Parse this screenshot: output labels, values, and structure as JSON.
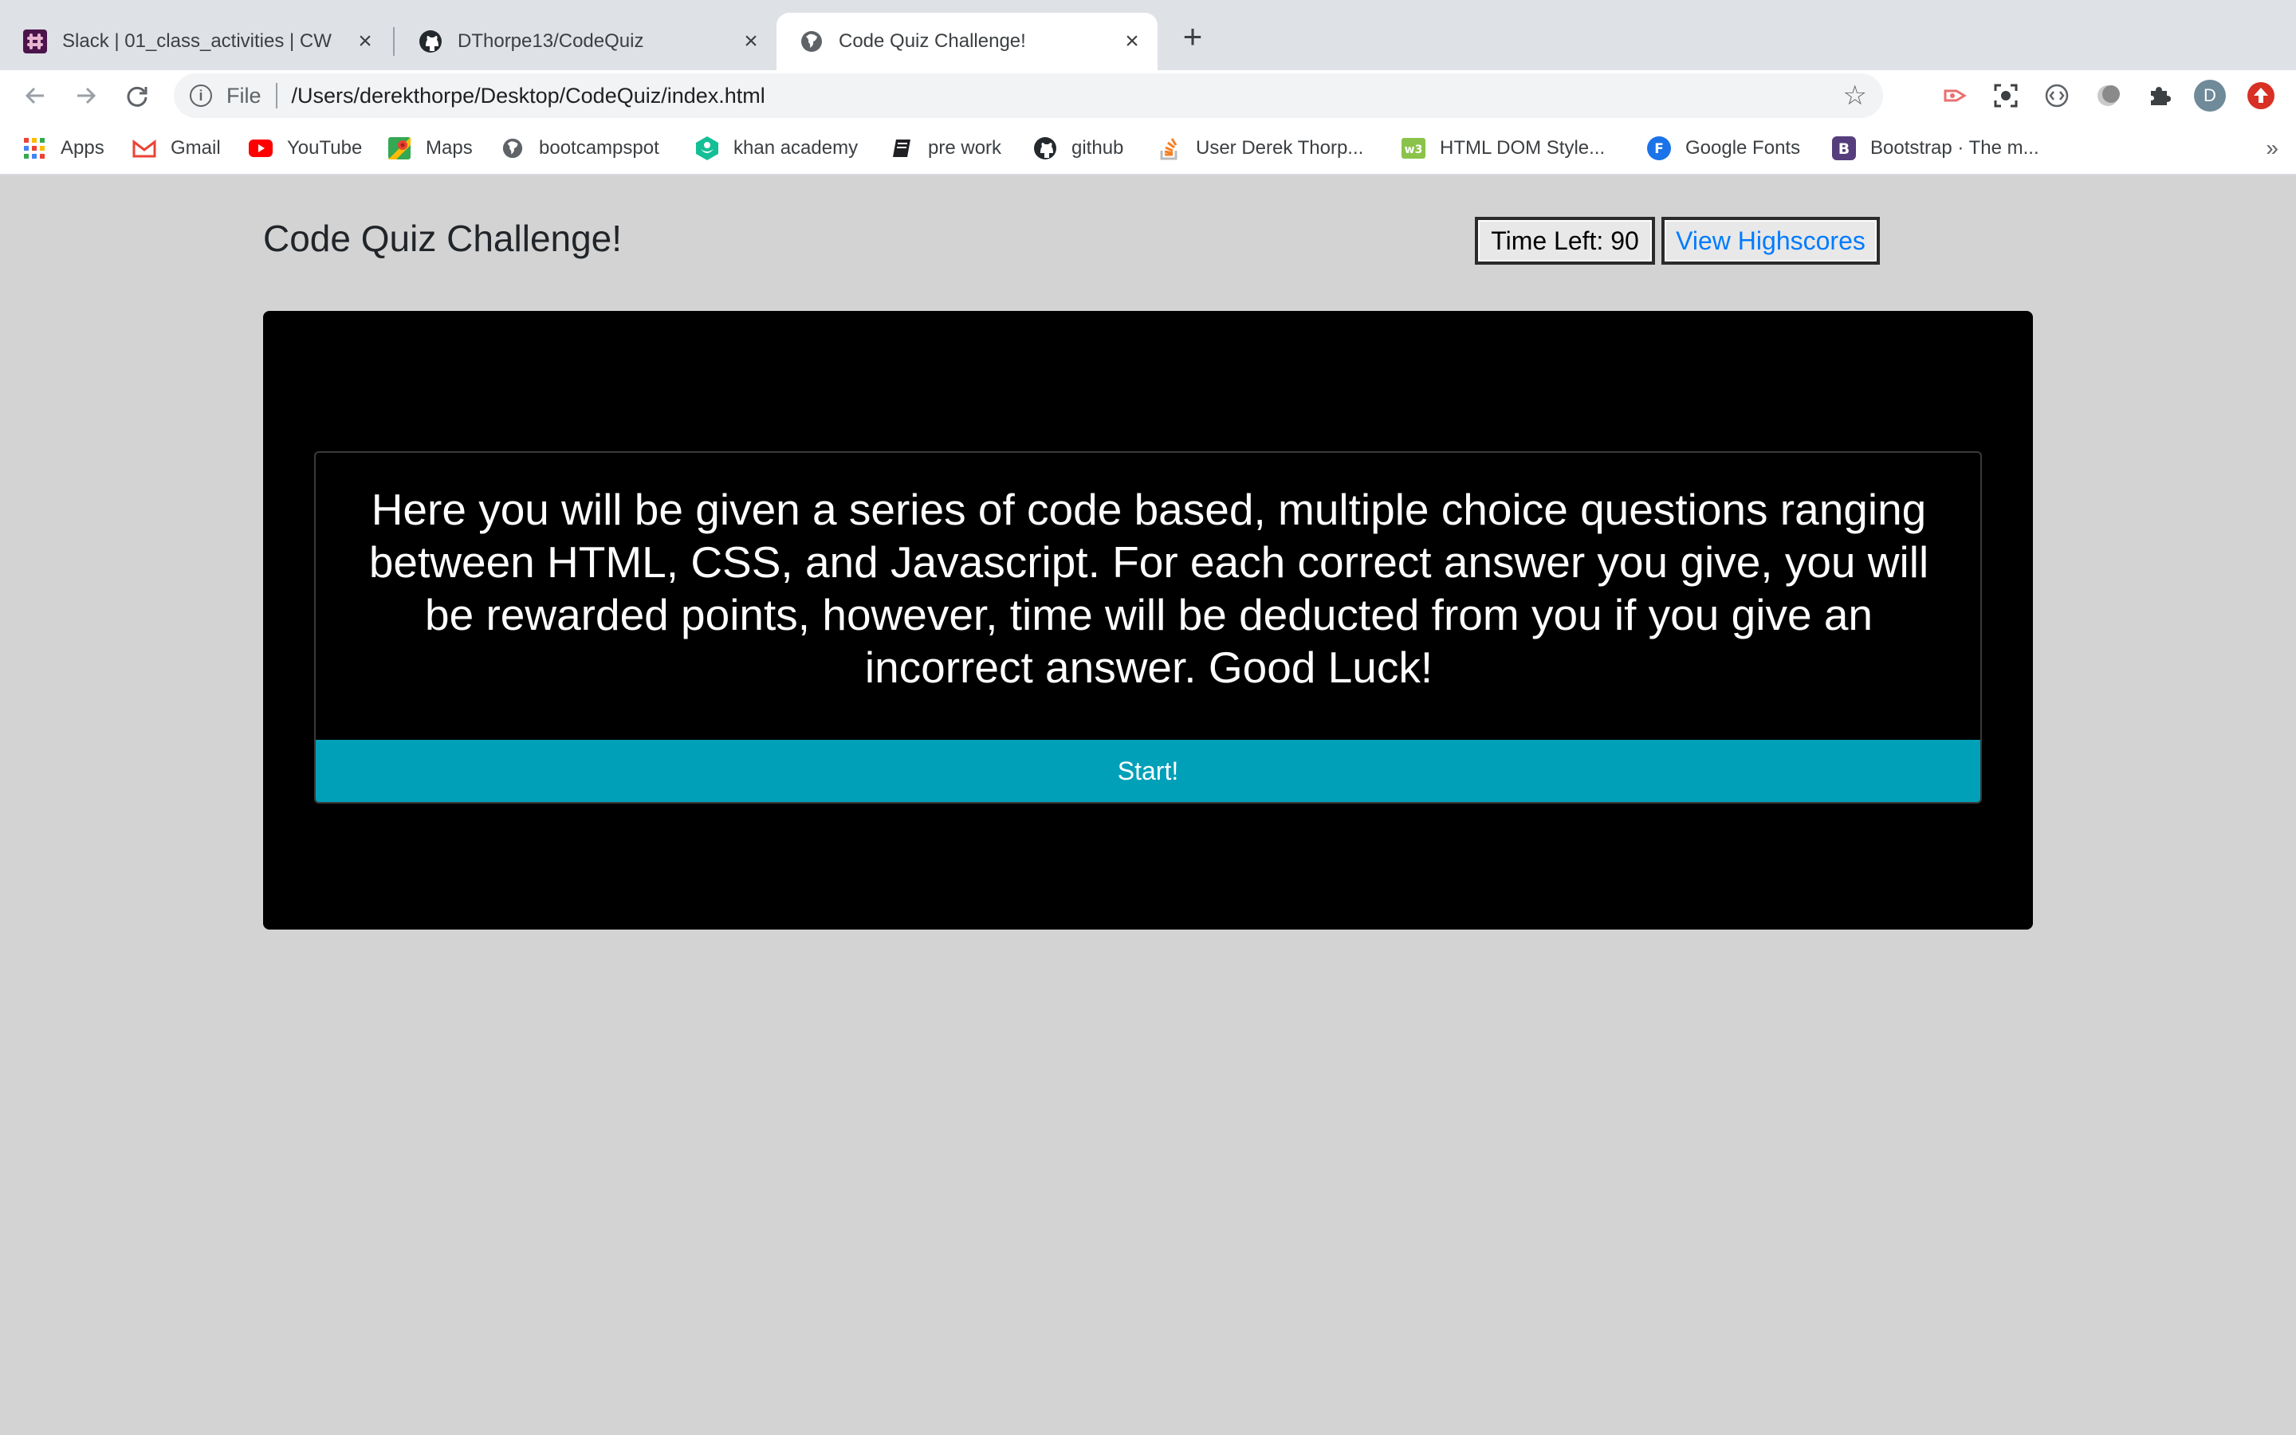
{
  "browser": {
    "tabs": [
      {
        "title": "Slack | 01_class_activities | CW",
        "icon": "slack-icon",
        "active": false
      },
      {
        "title": "DThorpe13/CodeQuiz",
        "icon": "github-icon",
        "active": false
      },
      {
        "title": "Code Quiz Challenge!",
        "icon": "globe-icon",
        "active": true
      }
    ],
    "address": {
      "scheme_label": "File",
      "url": "/Users/derekthorpe/Desktop/CodeQuiz/index.html"
    },
    "profile_initial": "D",
    "bookmarks": [
      {
        "label": "Apps",
        "icon": "apps-grid-icon"
      },
      {
        "label": "Gmail",
        "icon": "gmail-icon"
      },
      {
        "label": "YouTube",
        "icon": "youtube-icon"
      },
      {
        "label": "Maps",
        "icon": "maps-icon"
      },
      {
        "label": "bootcampspot",
        "icon": "globe-icon"
      },
      {
        "label": "khan academy",
        "icon": "khan-academy-icon"
      },
      {
        "label": "pre work",
        "icon": "book-icon"
      },
      {
        "label": "github",
        "icon": "github-icon"
      },
      {
        "label": "User Derek Thorp...",
        "icon": "stackoverflow-icon"
      },
      {
        "label": "HTML DOM Style...",
        "icon": "w3schools-icon"
      },
      {
        "label": "Google Fonts",
        "icon": "google-fonts-icon"
      },
      {
        "label": "Bootstrap · The m...",
        "icon": "bootstrap-icon"
      }
    ],
    "overflow_label": "»"
  },
  "page": {
    "title": "Code Quiz Challenge!",
    "timer_label": "Time Left: 90",
    "highscores_label": "View Highscores",
    "intro_text": "Here you will be given a series of code based, multiple choice questions ranging between HTML, CSS, and Javascript. For each correct answer you give, you will be rewarded points, however, time will be deducted from you if you give an incorrect answer. Good Luck!",
    "start_label": "Start!"
  },
  "colors": {
    "page_background": "#d3d3d3",
    "panel_background": "#000000",
    "start_button": "#00a0b8",
    "link": "#007bff"
  }
}
